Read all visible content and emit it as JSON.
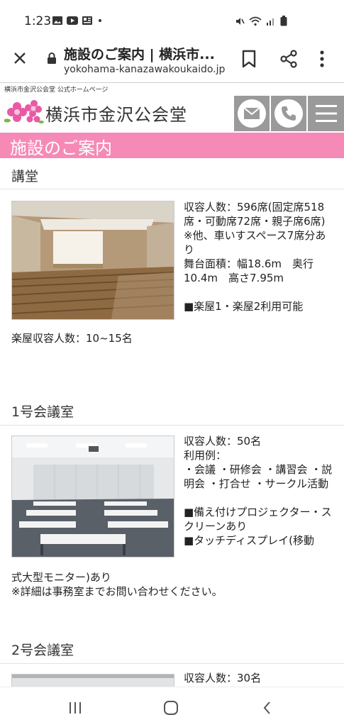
{
  "status_bar": {
    "time": "1:23",
    "icons_left": [
      "gallery-icon",
      "youtube-icon",
      "news-icon",
      "dot-icon"
    ],
    "icons_right": [
      "mute-icon",
      "wifi-icon",
      "signal-icon",
      "battery-icon"
    ]
  },
  "browser": {
    "tab_title": "施設のご案内 | 横浜市...",
    "url": "yokohama-kanazawakoukaido.jp"
  },
  "site": {
    "tagline": "横浜市金沢公会堂 公式ホームページ",
    "name": "横浜市金沢公会堂",
    "banner": "施設のご案内",
    "header_buttons": [
      "mail-icon",
      "phone-icon",
      "hamburger-menu-icon"
    ]
  },
  "sections": [
    {
      "title": "講堂",
      "desc": [
        "収容人数：596席(固定席518席・可動席72席・親子席6席)",
        "※他、車いすスペース7席分あり",
        "舞台面積：幅18.6m　奥行10.4m　高さ7.95m",
        "",
        "■楽屋1・楽屋2利用可能"
      ],
      "full": [
        "楽屋収容人数：10~15名"
      ]
    },
    {
      "title": "1号会議室",
      "desc": [
        "収容人数：50名",
        "利用例：",
        "・会議 ・研修会 ・講習会 ・説明会 ・打合せ ・サークル活動",
        "",
        "■備え付けプロジェクター・スクリーンあり",
        "■タッチディスプレイ(移動"
      ],
      "full": [
        "式大型モニター)あり",
        "※詳細は事務室までお問い合わせください。"
      ]
    },
    {
      "title": "2号会議室",
      "desc": [
        "収容人数：30名"
      ],
      "full": []
    }
  ],
  "nav": [
    "recent-apps-icon",
    "home-icon",
    "back-icon"
  ]
}
